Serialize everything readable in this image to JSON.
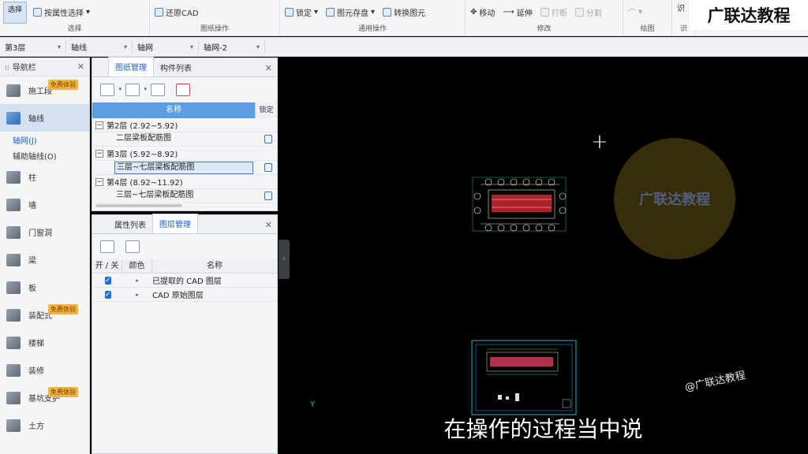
{
  "ribbon": {
    "select_label": "选择",
    "prop_select": "按属性选择",
    "restore_cad": "还原CAD",
    "lock": "锁定",
    "element_save": "图元存盘",
    "convert": "转换图元",
    "move": "移动",
    "extend": "延伸",
    "break": "打断",
    "split": "分割",
    "identify": "识",
    "groups": [
      "选择",
      "图纸操作",
      "通用操作",
      "修改",
      "绘图",
      "识"
    ]
  },
  "brand_watermark": "广联达教程",
  "filterbar": {
    "floor": "第3层",
    "type": "轴线",
    "subtype": "轴网",
    "instance": "轴网-2"
  },
  "nav": {
    "title": "导航栏",
    "items": [
      {
        "label": "施工段",
        "badge": "免费体验"
      },
      {
        "label": "轴线"
      },
      {
        "label": "柱"
      },
      {
        "label": "墙"
      },
      {
        "label": "门窗洞"
      },
      {
        "label": "梁"
      },
      {
        "label": "板"
      },
      {
        "label": "装配式",
        "badge": "免费体验"
      },
      {
        "label": "楼梯"
      },
      {
        "label": "装修"
      },
      {
        "label": "基坑支护",
        "badge": "免费体验"
      },
      {
        "label": "土方"
      }
    ],
    "subitems": [
      "轴网(J)",
      "辅助轴线(O)"
    ]
  },
  "drawing_panel": {
    "tabs": [
      "图纸管理",
      "构件列表"
    ],
    "columns": {
      "name": "名称",
      "lock": "锁定"
    },
    "rows": [
      {
        "type": "group",
        "label": "第2层 (2.92~5.92)"
      },
      {
        "type": "child",
        "label": "二层梁板配筋图"
      },
      {
        "type": "group",
        "label": "第3层 (5.92~8.92)"
      },
      {
        "type": "child",
        "label": "三层~七层梁板配筋图",
        "selected": true
      },
      {
        "type": "group",
        "label": "第4层 (8.92~11.92)"
      },
      {
        "type": "child",
        "label": "三层~七层梁板配筋图"
      }
    ]
  },
  "layer_panel": {
    "tabs": [
      "属性列表",
      "图层管理"
    ],
    "columns": [
      "开 / 关",
      "颜色",
      "名称"
    ],
    "rows": [
      {
        "name": "已提取的 CAD 图层",
        "on": true
      },
      {
        "name": "CAD 原始图层",
        "on": true
      }
    ]
  },
  "canvas": {
    "subtitle": "在操作的过程当中说",
    "watermark": "@广联达教程",
    "logo_text": "广联达教程",
    "axis_label": "Y"
  }
}
